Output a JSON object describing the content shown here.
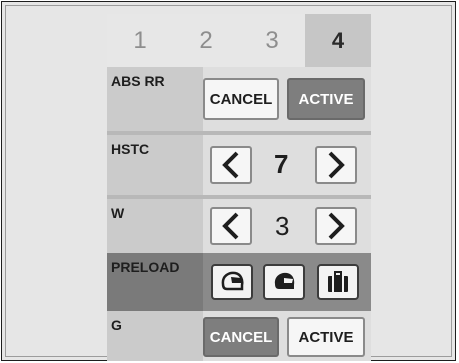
{
  "tabs": [
    "1",
    "2",
    "3",
    "4"
  ],
  "rows": {
    "abs": {
      "label": "ABS RR",
      "cancel": "CANCEL",
      "active": "ACTIVE"
    },
    "hstc": {
      "label": "HSTC",
      "value": "7"
    },
    "w": {
      "label": "W",
      "value": "3"
    },
    "preload": {
      "label": "PRELOAD",
      "icons": [
        "rider-helmet-icon",
        "passenger-helmet-icon",
        "luggage-icon"
      ]
    },
    "g": {
      "label": "G",
      "cancel": "CANCEL",
      "active": "ACTIVE"
    }
  }
}
